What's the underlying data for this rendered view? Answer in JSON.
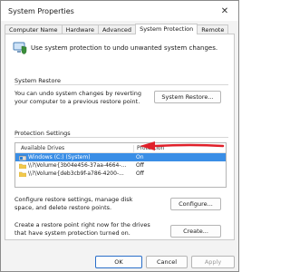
{
  "window": {
    "title": "System Properties",
    "close_glyph": "✕"
  },
  "tabs": [
    {
      "label": "Computer Name"
    },
    {
      "label": "Hardware"
    },
    {
      "label": "Advanced"
    },
    {
      "label": "System Protection"
    },
    {
      "label": "Remote"
    }
  ],
  "intro": {
    "text": "Use system protection to undo unwanted system changes.",
    "icon": "shield-computer-icon"
  },
  "system_restore": {
    "heading": "System Restore",
    "description": "You can undo system changes by reverting your computer to a previous restore point.",
    "button_label": "System Restore..."
  },
  "protection_settings": {
    "heading": "Protection Settings",
    "columns": [
      "Available Drives",
      "Protection"
    ],
    "drives": [
      {
        "name": "Windows (C:) (System)",
        "protection": "On",
        "selected": true,
        "icon": "windows-drive-icon"
      },
      {
        "name": "\\\\?\\Volume{3b04e456-37aa-4664-...",
        "protection": "Off",
        "selected": false,
        "icon": "folder-icon"
      },
      {
        "name": "\\\\?\\Volume{deb3cb9f-a786-4200-...",
        "protection": "Off",
        "selected": false,
        "icon": "folder-icon"
      }
    ],
    "configure_description": "Configure restore settings, manage disk space, and delete restore points.",
    "configure_button": "Configure...",
    "create_description": "Create a restore point right now for the drives that have system protection turned on.",
    "create_button": "Create..."
  },
  "footer": {
    "ok": "OK",
    "cancel": "Cancel",
    "apply": "Apply"
  },
  "colors": {
    "selection": "#3a8ee6",
    "annotation_arrow": "#e0202a"
  }
}
